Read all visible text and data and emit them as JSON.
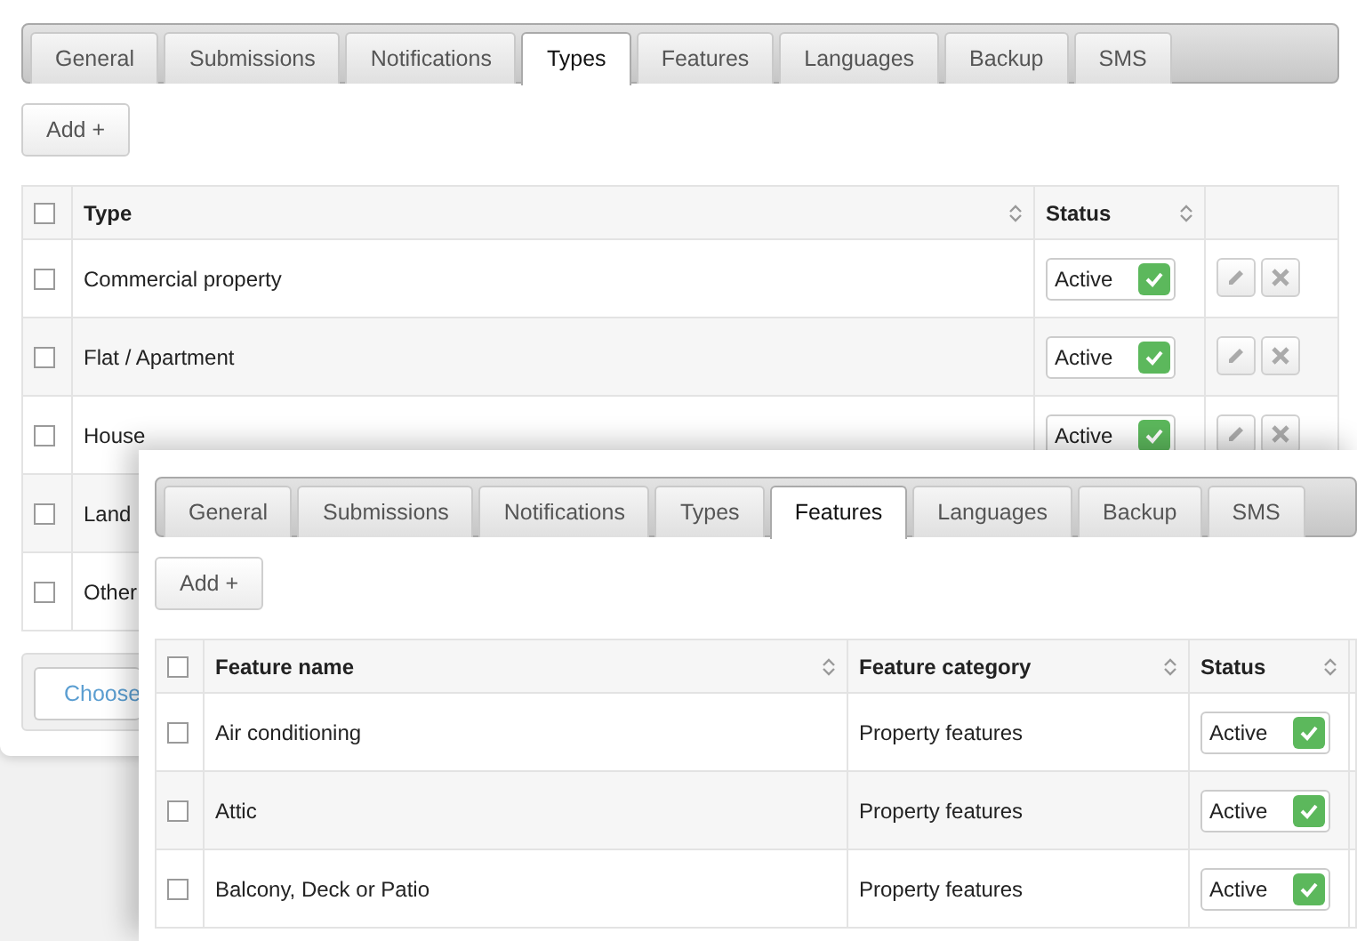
{
  "panels": [
    {
      "kind": "base",
      "tabs": [
        {
          "label": "General",
          "selected": false
        },
        {
          "label": "Submissions",
          "selected": false
        },
        {
          "label": "Notifications",
          "selected": false
        },
        {
          "label": "Types",
          "selected": true
        },
        {
          "label": "Features",
          "selected": false
        },
        {
          "label": "Languages",
          "selected": false
        },
        {
          "label": "Backup",
          "selected": false
        },
        {
          "label": "SMS",
          "selected": false
        }
      ],
      "add_button": "Add +",
      "header_checkbox": {
        "checked": false
      },
      "columns": [
        {
          "kind": "text",
          "label": "Type"
        },
        {
          "kind": "status",
          "label": "Status"
        },
        {
          "kind": "actions"
        }
      ],
      "rows": [
        {
          "checked": false,
          "cells": [
            "Commercial property",
            {
              "label": "Active",
              "active": true
            },
            {
              "edit": true,
              "delete": true
            }
          ]
        },
        {
          "checked": false,
          "cells": [
            "Flat / Apartment",
            {
              "label": "Active",
              "active": true
            },
            {
              "edit": true,
              "delete": true
            }
          ]
        },
        {
          "checked": false,
          "cells": [
            "House",
            {
              "label": "Active",
              "active": true
            },
            {
              "edit": true,
              "delete": true
            }
          ]
        },
        {
          "checked": false,
          "cells": [
            "Land"
          ]
        },
        {
          "checked": false,
          "cells": [
            "Other"
          ]
        }
      ],
      "footer_button": "Choose"
    },
    {
      "kind": "overlay",
      "tabs": [
        {
          "label": "General",
          "selected": false
        },
        {
          "label": "Submissions",
          "selected": false
        },
        {
          "label": "Notifications",
          "selected": false
        },
        {
          "label": "Types",
          "selected": false
        },
        {
          "label": "Features",
          "selected": true
        },
        {
          "label": "Languages",
          "selected": false
        },
        {
          "label": "Backup",
          "selected": false
        },
        {
          "label": "SMS",
          "selected": false
        }
      ],
      "add_button": "Add +",
      "header_checkbox": {
        "checked": false
      },
      "columns": [
        {
          "kind": "text",
          "label": "Feature name"
        },
        {
          "kind": "text",
          "label": "Feature category"
        },
        {
          "kind": "status",
          "label": "Status"
        }
      ],
      "rows": [
        {
          "checked": false,
          "cells": [
            "Air conditioning",
            "Property features",
            {
              "label": "Active",
              "active": true
            }
          ]
        },
        {
          "checked": false,
          "cells": [
            "Attic",
            "Property features",
            {
              "label": "Active",
              "active": true
            }
          ]
        },
        {
          "checked": false,
          "cells": [
            "Balcony, Deck or Patio",
            "Property features",
            {
              "label": "Active",
              "active": true
            }
          ]
        }
      ]
    }
  ]
}
